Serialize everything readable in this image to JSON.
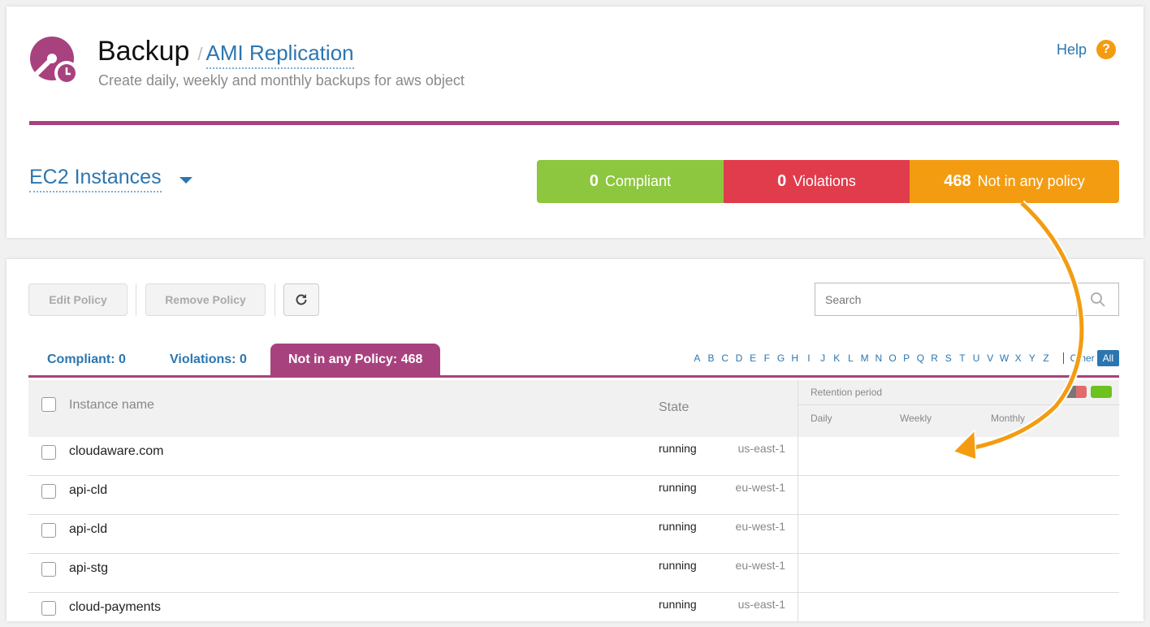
{
  "header": {
    "title": "Backup",
    "separator": "/",
    "subtitle": "AMI Replication",
    "description": "Create daily, weekly and monthly backups for aws object",
    "help_label": "Help",
    "help_icon": "?"
  },
  "selector": {
    "label": "EC2 Instances"
  },
  "stats": {
    "compliant": {
      "count": "0",
      "label": "Compliant",
      "color": "#8dc63f"
    },
    "violations": {
      "count": "0",
      "label": "Violations",
      "color": "#e03c4c"
    },
    "not_in_policy": {
      "count": "468",
      "label": "Not in any policy",
      "color": "#f39c12"
    }
  },
  "toolbar": {
    "edit_label": "Edit Policy",
    "remove_label": "Remove Policy",
    "search_placeholder": "Search"
  },
  "tabs": [
    {
      "label": "Compliant:  0"
    },
    {
      "label": "Violations:  0"
    },
    {
      "label": "Not in any Policy: 468",
      "active": true
    }
  ],
  "alphabet": [
    "A",
    "B",
    "C",
    "D",
    "E",
    "F",
    "G",
    "H",
    "I",
    "J",
    "K",
    "L",
    "M",
    "N",
    "O",
    "P",
    "Q",
    "R",
    "S",
    "T",
    "U",
    "V",
    "W",
    "X",
    "Y",
    "Z"
  ],
  "alpha_other": "Other",
  "alpha_all": "All",
  "table": {
    "col_name": "Instance name",
    "col_state": "State",
    "retention_title": "Retention period",
    "retention_daily": "Daily",
    "retention_weekly": "Weekly",
    "retention_monthly": "Monthly",
    "rows": [
      {
        "name": "cloudaware.com",
        "state": "running",
        "region": "us-east-1"
      },
      {
        "name": "api-cld",
        "state": "running",
        "region": "eu-west-1"
      },
      {
        "name": "api-cld",
        "state": "running",
        "region": "eu-west-1"
      },
      {
        "name": "api-stg",
        "state": "running",
        "region": "eu-west-1"
      },
      {
        "name": "cloud-payments",
        "state": "running",
        "region": "us-east-1"
      }
    ]
  },
  "colors": {
    "accent": "#a8427e",
    "link": "#2c76b0",
    "arrow": "#f39c12"
  }
}
